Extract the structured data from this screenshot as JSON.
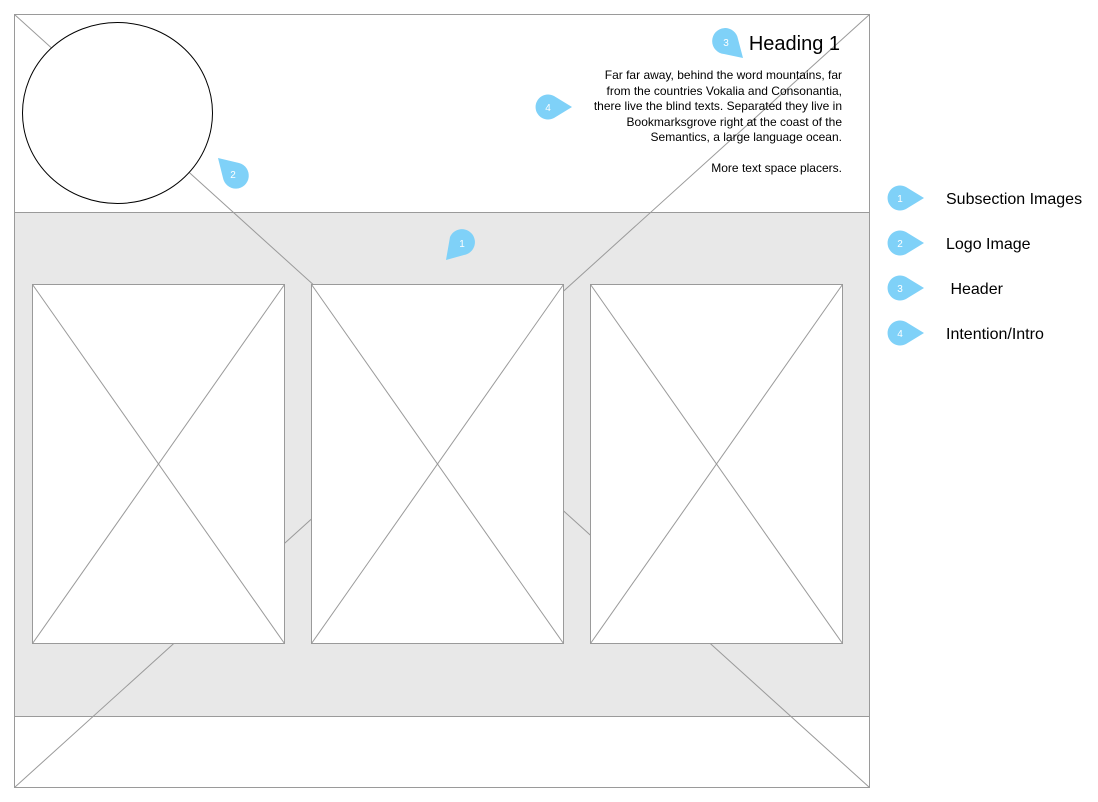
{
  "header": {
    "heading": "Heading 1",
    "intro_text": "Far far away, behind the word mountains, far from the countries Vokalia and Consonantia, there live the blind texts. Separated they live in Bookmarksgrove right at the coast of the Semantics, a large language ocean.",
    "more_text": "More text space placers."
  },
  "markers": [
    {
      "number": "1",
      "target": "subsection-images"
    },
    {
      "number": "2",
      "target": "logo-image"
    },
    {
      "number": "3",
      "target": "header"
    },
    {
      "number": "4",
      "target": "intention-intro"
    }
  ],
  "legend": [
    {
      "number": "1",
      "label": "Subsection Images"
    },
    {
      "number": "2",
      "label": "Logo Image"
    },
    {
      "number": "3",
      "label": " Header"
    },
    {
      "number": "4",
      "label": "Intention/Intro"
    }
  ],
  "colors": {
    "marker": "#7fd1f8",
    "marker_text": "#ffffff",
    "band": "#e8e8e8",
    "wire_line": "#9a9a9a"
  }
}
